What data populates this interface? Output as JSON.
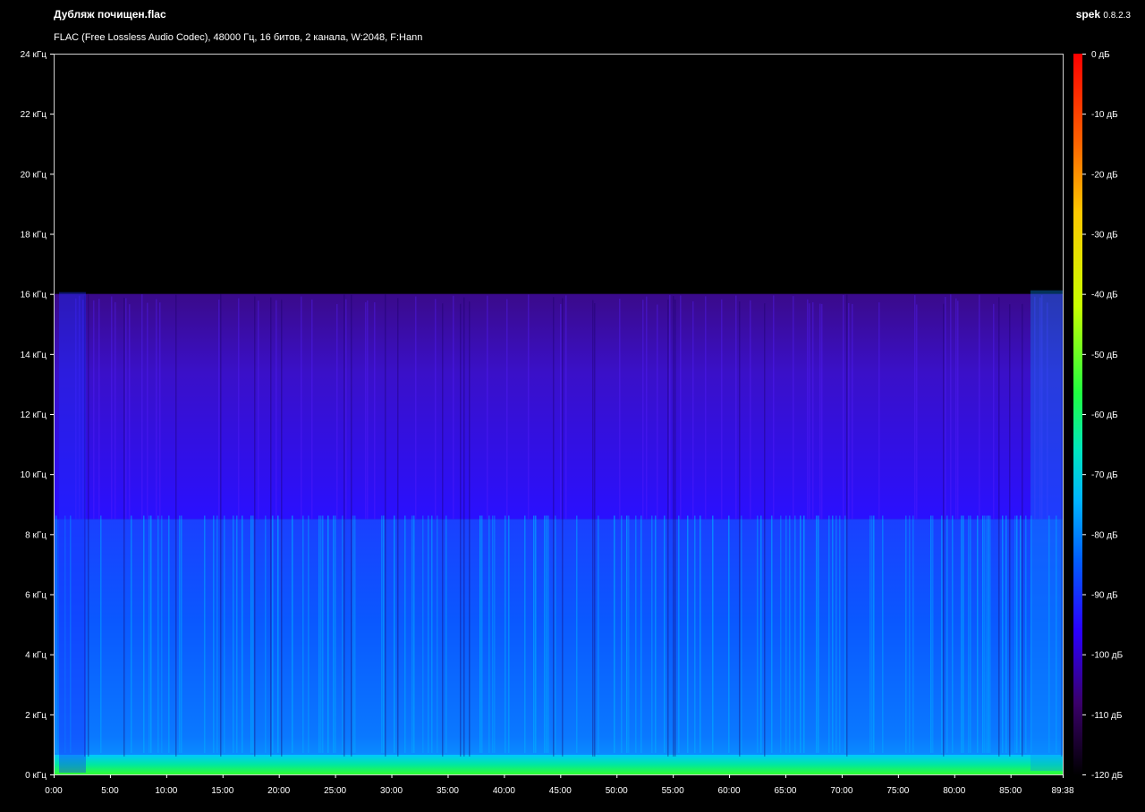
{
  "header": {
    "file_name": "Дубляж почищен.flac",
    "file_info": "FLAC (Free Lossless Audio Codec), 48000 Гц, 16 битов, 2 канала, W:2048, F:Hann",
    "app_name": "spek",
    "app_version": "0.8.2.3"
  },
  "chart_data": {
    "type": "heatmap",
    "title": "",
    "ylabel": "",
    "xlabel": "",
    "y_ticks": [
      "0 кГц",
      "2 кГц",
      "4 кГц",
      "6 кГц",
      "8 кГц",
      "10 кГц",
      "12 кГц",
      "14 кГц",
      "16 кГц",
      "18 кГц",
      "20 кГц",
      "22 кГц",
      "24 кГц"
    ],
    "ylim_khz": [
      0,
      24
    ],
    "x_ticks": [
      "0:00",
      "5:00",
      "10:00",
      "15:00",
      "20:00",
      "25:00",
      "30:00",
      "35:00",
      "40:00",
      "45:00",
      "50:00",
      "55:00",
      "60:00",
      "65:00",
      "70:00",
      "75:00",
      "80:00",
      "85:00",
      "89:38"
    ],
    "xlim_seconds": [
      0,
      5378
    ],
    "colorbar_ticks": [
      "0 дБ",
      "-10 дБ",
      "-20 дБ",
      "-30 дБ",
      "-40 дБ",
      "-50 дБ",
      "-60 дБ",
      "-70 дБ",
      "-80 дБ",
      "-90 дБ",
      "-100 дБ",
      "-110 дБ",
      "-120 дБ"
    ],
    "colorbar_range_db": [
      -120,
      0
    ],
    "colormap": [
      "#000000",
      "#3a006a",
      "#2a00ff",
      "#0060ff",
      "#00b4ff",
      "#00e6c0",
      "#20ff40",
      "#c8ff00",
      "#ffc800",
      "#ff6000",
      "#ff0000"
    ],
    "content_cutoff_khz": 16,
    "dense_content_cutoff_khz": 8.5
  }
}
